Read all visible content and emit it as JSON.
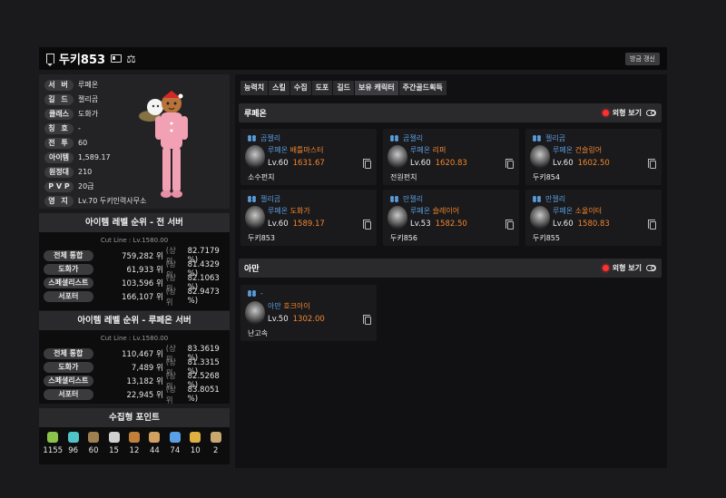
{
  "header": {
    "title": "두키853",
    "refresh_label": "방금 갱신"
  },
  "profile": {
    "rows": [
      {
        "label": "서 버",
        "value": "루페온"
      },
      {
        "label": "길 드",
        "value": "젤리곰"
      },
      {
        "label": "클래스",
        "value": "도화가"
      },
      {
        "label": "칭 호",
        "value": "-"
      },
      {
        "label": "전 투",
        "value": "60"
      },
      {
        "label": "아이템",
        "value": "1,589.17"
      },
      {
        "label": "원정대",
        "value": "210"
      },
      {
        "label": "P V P",
        "value": "20급"
      },
      {
        "label": "영 지",
        "value": "Lv.70 두키인력사무소"
      }
    ]
  },
  "rank_all": {
    "title": "아이템 레벨 순위 - 전 서버",
    "cutline": "Cut Line : Lv.1580.00",
    "rows": [
      {
        "label": "전체 통합",
        "rank": "759,282 위",
        "sang": "(상위",
        "pct": "82.7179 %)"
      },
      {
        "label": "도화가",
        "rank": "61,933 위",
        "sang": "(상위",
        "pct": "81.4329 %)"
      },
      {
        "label": "스페셜리스트",
        "rank": "103,596 위",
        "sang": "(상위",
        "pct": "82.1063 %)"
      },
      {
        "label": "서포터",
        "rank": "166,107 위",
        "sang": "(상위",
        "pct": "82.9473 %)"
      }
    ]
  },
  "rank_server": {
    "title": "아이템 레벨 순위 - 루페온 서버",
    "cutline": "Cut Line : Lv.1580.00",
    "rows": [
      {
        "label": "전체 통합",
        "rank": "110,467 위",
        "sang": "(상위",
        "pct": "83.3619 %)"
      },
      {
        "label": "도화가",
        "rank": "7,489 위",
        "sang": "(상위",
        "pct": "81.3315 %)"
      },
      {
        "label": "스페셜리스트",
        "rank": "13,182 위",
        "sang": "(상위",
        "pct": "82.5268 %)"
      },
      {
        "label": "서포터",
        "rank": "22,945 위",
        "sang": "(상위",
        "pct": "83.8051 %)"
      }
    ]
  },
  "collect": {
    "title": "수집형 포인트",
    "items": [
      {
        "icon": "mokoko-seed-icon",
        "value": "1155",
        "color": "#8bc34a"
      },
      {
        "icon": "island-heart-icon",
        "value": "96",
        "color": "#4fc3c7"
      },
      {
        "icon": "great-art-icon",
        "value": "60",
        "color": "#a08050"
      },
      {
        "icon": "giant-heart-icon",
        "value": "15",
        "color": "#d0d0d0"
      },
      {
        "icon": "ignea-token-icon",
        "value": "12",
        "color": "#c0803a"
      },
      {
        "icon": "sea-bounty-icon",
        "value": "44",
        "color": "#d2a060"
      },
      {
        "icon": "world-tree-leaf-icon",
        "value": "74",
        "color": "#5aa0e6"
      },
      {
        "icon": "orpheus-star-icon",
        "value": "10",
        "color": "#e0b040"
      },
      {
        "icon": "orgel-icon",
        "value": "2",
        "color": "#c9a870"
      }
    ]
  },
  "tabs": [
    "능력치",
    "스킬",
    "수집",
    "도포",
    "길드",
    "보유 캐릭터",
    "주간골드획득"
  ],
  "sections": [
    {
      "name": "루페온",
      "look_label": "외형 보기",
      "cards": [
        {
          "guild": "곰젤리",
          "server": "루페온",
          "cls": "배틀마스터",
          "lv": "Lv.60",
          "il": "1631.67",
          "name": "소수펀치"
        },
        {
          "guild": "곰젤리",
          "server": "루페온",
          "cls": "리퍼",
          "lv": "Lv.60",
          "il": "1620.83",
          "name": "전원펀치"
        },
        {
          "guild": "젤리곰",
          "server": "루페온",
          "cls": "건슬링어",
          "lv": "Lv.60",
          "il": "1602.50",
          "name": "두키854"
        },
        {
          "guild": "젤리곰",
          "server": "루페온",
          "cls": "도화가",
          "lv": "Lv.60",
          "il": "1589.17",
          "name": "두키853"
        },
        {
          "guild": "만젤리",
          "server": "루페온",
          "cls": "슬레이어",
          "lv": "Lv.53",
          "il": "1582.50",
          "name": "두키856"
        },
        {
          "guild": "만젤리",
          "server": "루페온",
          "cls": "소울이터",
          "lv": "Lv.60",
          "il": "1580.83",
          "name": "두키855"
        }
      ]
    },
    {
      "name": "아만",
      "look_label": "외형 보기",
      "cards": [
        {
          "guild": "-",
          "server": "아만",
          "cls": "호크아이",
          "lv": "Lv.50",
          "il": "1302.00",
          "name": "난고속"
        }
      ]
    }
  ],
  "colors": {
    "accent_blue": "#5a9bdc",
    "accent_orange": "#f2852e",
    "look_dot": "#ff3030"
  }
}
